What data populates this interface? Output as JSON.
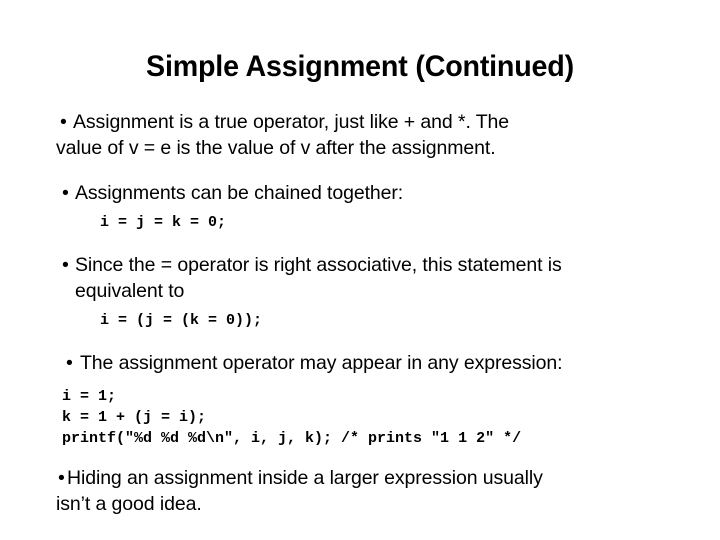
{
  "slide": {
    "title": "Simple Assignment (Continued)",
    "bullet_glyph": "•",
    "blocks": {
      "b1_line1": "Assignment is a true operator, just like + and *. The",
      "b1_line2": "value of v = e is the value of v after the assignment.",
      "b2_text": "Assignments can be chained together:",
      "b2_code": "i = j = k = 0;",
      "b3_line1": "Since the = operator is right associative, this statement is",
      "b3_line2": "equivalent to",
      "b3_code": "i = (j = (k = 0));",
      "b4_text": "The assignment operator may appear in any expression:",
      "b4_code_line1": "i = 1;",
      "b4_code_line2": "k = 1 + (j = i);",
      "b4_code_line3": "printf(\"%d %d %d\\n\", i, j, k); /* prints \"1 1 2\" */",
      "b5_line1": "Hiding an assignment inside a larger expression usually",
      "b5_line2": "isn’t a good idea."
    },
    "colors": {
      "background": "#ffffff",
      "text": "#000000"
    }
  }
}
